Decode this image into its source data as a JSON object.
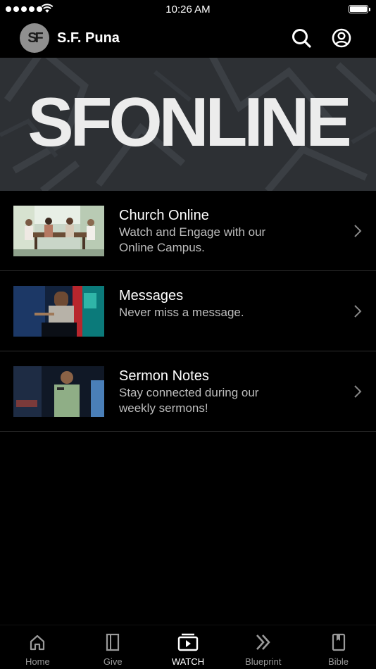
{
  "status_bar": {
    "time": "10:26 AM"
  },
  "header": {
    "avatar_text": "SF",
    "title": "S.F. Puna"
  },
  "hero": {
    "title": "SFONLINE"
  },
  "menu": [
    {
      "title": "Church Online",
      "subtitle_line1": "Watch and Engage with our",
      "subtitle_line2": "Online Campus."
    },
    {
      "title": "Messages",
      "subtitle_line1": "Never miss a message.",
      "subtitle_line2": ""
    },
    {
      "title": "Sermon Notes",
      "subtitle_line1": "Stay connected during our",
      "subtitle_line2": "weekly sermons!"
    }
  ],
  "tabs": [
    {
      "label": "Home",
      "icon": "home-icon",
      "active": false
    },
    {
      "label": "Give",
      "icon": "give-icon",
      "active": false
    },
    {
      "label": "WATCH",
      "icon": "watch-icon",
      "active": true
    },
    {
      "label": "Blueprint",
      "icon": "blueprint-icon",
      "active": false
    },
    {
      "label": "Bible",
      "icon": "bible-icon",
      "active": false
    }
  ],
  "colors": {
    "background": "#000000",
    "hero_bg": "#2d3034",
    "text_secondary": "#bdbdbd",
    "tab_inactive": "#9a9a9a"
  }
}
